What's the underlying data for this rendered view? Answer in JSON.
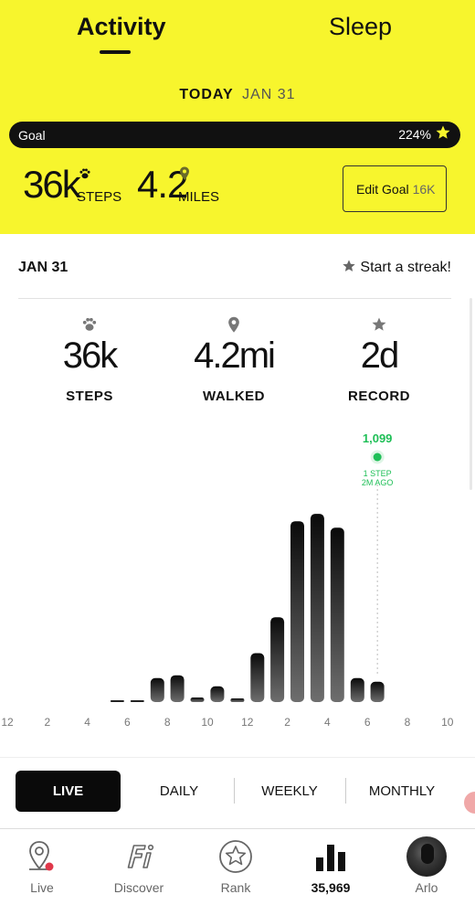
{
  "tabs": {
    "activity": "Activity",
    "sleep": "Sleep"
  },
  "today": {
    "label": "TODAY",
    "date": "JAN 31"
  },
  "goal": {
    "label": "Goal",
    "percent": "224%",
    "progress": 1.0
  },
  "summary": {
    "steps_value": "36k",
    "steps_unit": "STEPS",
    "miles_value": "4.2",
    "miles_unit": "MILES",
    "edit_goal_label": "Edit Goal",
    "edit_goal_value": "16K"
  },
  "day": {
    "date": "JAN 31",
    "streak": "Start a streak!"
  },
  "stats": {
    "steps": {
      "value": "36k",
      "label": "STEPS"
    },
    "walked": {
      "value": "4.2mi",
      "label": "WALKED"
    },
    "record": {
      "value": "2d",
      "label": "RECORD"
    }
  },
  "chart_data": {
    "type": "bar",
    "categories": [
      "12a",
      "1a",
      "2a",
      "3a",
      "4a",
      "5a",
      "6a",
      "7a",
      "8a",
      "9a",
      "10a",
      "11a",
      "12p",
      "1p",
      "2p",
      "3p",
      "4p",
      "5p",
      "6p",
      "7p",
      "8p",
      "9p",
      "10p",
      "11p"
    ],
    "values": [
      0,
      0,
      0,
      0,
      0,
      50,
      50,
      1300,
      1450,
      250,
      850,
      200,
      2650,
      4600,
      9800,
      10200,
      9450,
      1300,
      1099,
      0,
      0,
      0,
      0,
      0
    ],
    "ylim": [
      0,
      11000
    ],
    "tick_labels": [
      "12",
      "2",
      "4",
      "6",
      "8",
      "10",
      "12",
      "2",
      "4",
      "6",
      "8",
      "10"
    ],
    "annotation": {
      "value": "1,099",
      "line1": "1 STEP",
      "line2": "2M AGO",
      "index": 18
    }
  },
  "periods": {
    "live": "LIVE",
    "daily": "DAILY",
    "weekly": "WEEKLY",
    "monthly": "MONTHLY"
  },
  "nav": {
    "live": "Live",
    "discover": "Discover",
    "rank": "Rank",
    "count": "35,969",
    "arlo": "Arlo"
  },
  "colors": {
    "accent": "#f7f52d",
    "annotation": "#1fbf57"
  }
}
